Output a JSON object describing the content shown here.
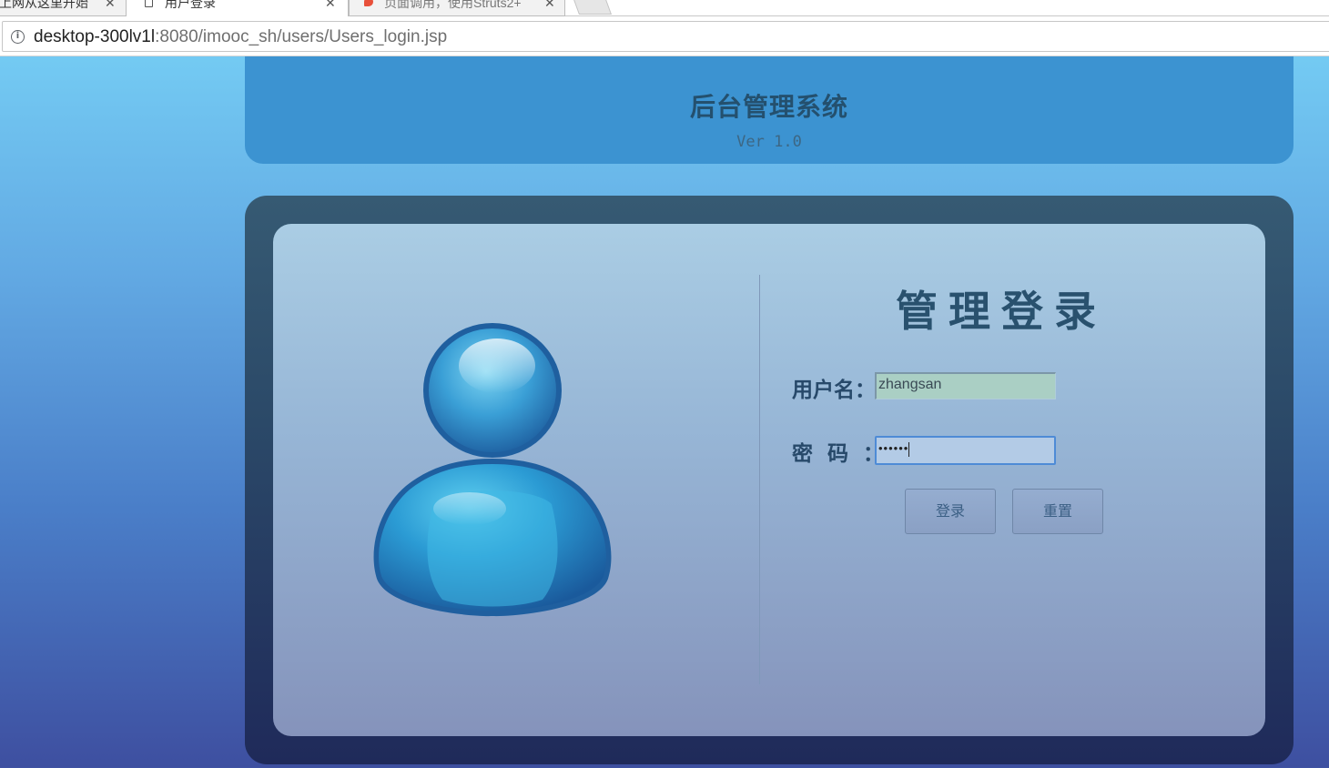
{
  "browser": {
    "tabs": [
      {
        "label": "上网从这里开始",
        "close": "✕"
      },
      {
        "label": "用户登录",
        "close": "✕"
      },
      {
        "label": "页面调用，使用Struts2+",
        "close": "✕"
      }
    ],
    "url_host": "desktop-300lv1l",
    "url_path": ":8080/imooc_sh/users/Users_login.jsp"
  },
  "header": {
    "title": "后台管理系统",
    "version": "Ver 1.0"
  },
  "login": {
    "title": "管理登录",
    "username_label": "用户名",
    "username_value": "zhangsan",
    "password_label": "密码",
    "colon": "：",
    "password_mask": "••••••",
    "login_button": "登录",
    "reset_button": "重置"
  },
  "colors": {
    "background_top": "#78d3f7",
    "background_bottom": "#3e4fa0",
    "header_panel": "#3c93d1",
    "frame": "#2b4968",
    "title_text": "#29516e"
  },
  "icons": {
    "avatar": "user-avatar-icon",
    "info": "info-icon",
    "document": "document-icon"
  }
}
